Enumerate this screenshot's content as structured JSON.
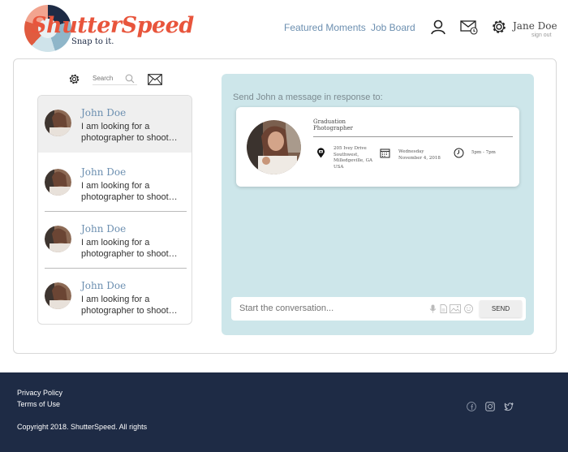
{
  "header": {
    "logo_text": "ShutterSpeed",
    "logo_tagline": "Snap to it.",
    "nav": [
      "Featured Moments",
      "Job Board"
    ],
    "user_name": "Jane Doe",
    "sign_out": "sign out"
  },
  "sidebar": {
    "search_placeholder": "Search",
    "conversations": [
      {
        "name": "John Doe",
        "snippet": "I am looking for a photographer to shoot…"
      },
      {
        "name": "John Doe",
        "snippet": "I am looking for a photographer to shoot…"
      },
      {
        "name": "John Doe",
        "snippet": "I am looking for a photographer to shoot…"
      },
      {
        "name": "John Doe",
        "snippet": "I am looking for a photographer to shoot…"
      }
    ]
  },
  "message_panel": {
    "title": "Send John a message in response to:",
    "job": {
      "title": "Graduation Photographer",
      "address": "205 Ivey Drive Southwest, Milledgeville, GA USA",
      "date": "Wednesday November 4, 2018",
      "time": "5pm - 7pm"
    },
    "input_placeholder": "Start the conversation...",
    "send_label": "SEND"
  },
  "footer": {
    "privacy": "Privacy Policy",
    "terms": "Terms of Use",
    "copyright": "Copyright 2018. ShutterSpeed. All rights"
  },
  "colors": {
    "brand": "#e8553c",
    "navy": "#1e2b45",
    "panel": "#cde6ea",
    "link": "#6c8fb0"
  }
}
